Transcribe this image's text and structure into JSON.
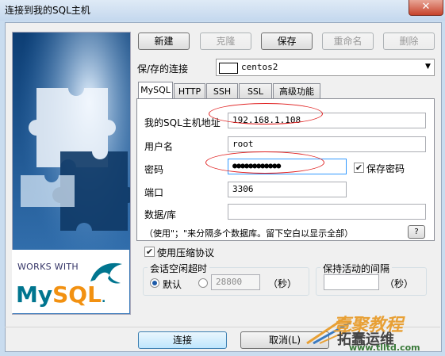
{
  "window": {
    "title": "连接到我的SQL主机",
    "close_glyph": "✕"
  },
  "left_panel": {
    "works_with": "WORKS WITH",
    "logo_my": "My",
    "logo_sql": "SQL",
    "logo_dot": "."
  },
  "toolbar": {
    "new": "新建",
    "clone": "克隆",
    "save": "保存",
    "rename": "重命名",
    "delete": "删除"
  },
  "saved_connection": {
    "label": "保/存的连接",
    "value": "centos2"
  },
  "tabs": [
    "MySQL",
    "HTTP",
    "SSH",
    "SSL",
    "高级功能"
  ],
  "form": {
    "host_label": "我的SQL主机地址",
    "host_value": "192.168.1.108",
    "user_label": "用户名",
    "user_value": "root",
    "password_label": "密码",
    "password_value": "●●●●●●●●●●●●",
    "save_password_label": "保存密码",
    "port_label": "端口",
    "port_value": "3306",
    "database_label": "数据/库",
    "database_value": "",
    "hint": "（使用\"；\"来分隔多个数据库。留下空白以显示全部）",
    "help_button": "?"
  },
  "compression": {
    "label": "使用压缩协议",
    "checked": true
  },
  "session_timeout": {
    "title": "会话空闲超时",
    "default_label": "默认",
    "custom_value": "28800",
    "unit": "（秒）"
  },
  "keepalive": {
    "title": "保持活动的间隔",
    "value": "",
    "unit": "（秒）"
  },
  "footer": {
    "connect": "连接",
    "cancel": "取消(L)"
  },
  "watermark": {
    "line1": "壹聚教程",
    "line2": "拓蠢运维",
    "line3": "www.tlltd.com"
  },
  "colors": {
    "accent": "#3c7fb1",
    "annotation": "#e02020",
    "titlebar": "#c4d8ee"
  }
}
